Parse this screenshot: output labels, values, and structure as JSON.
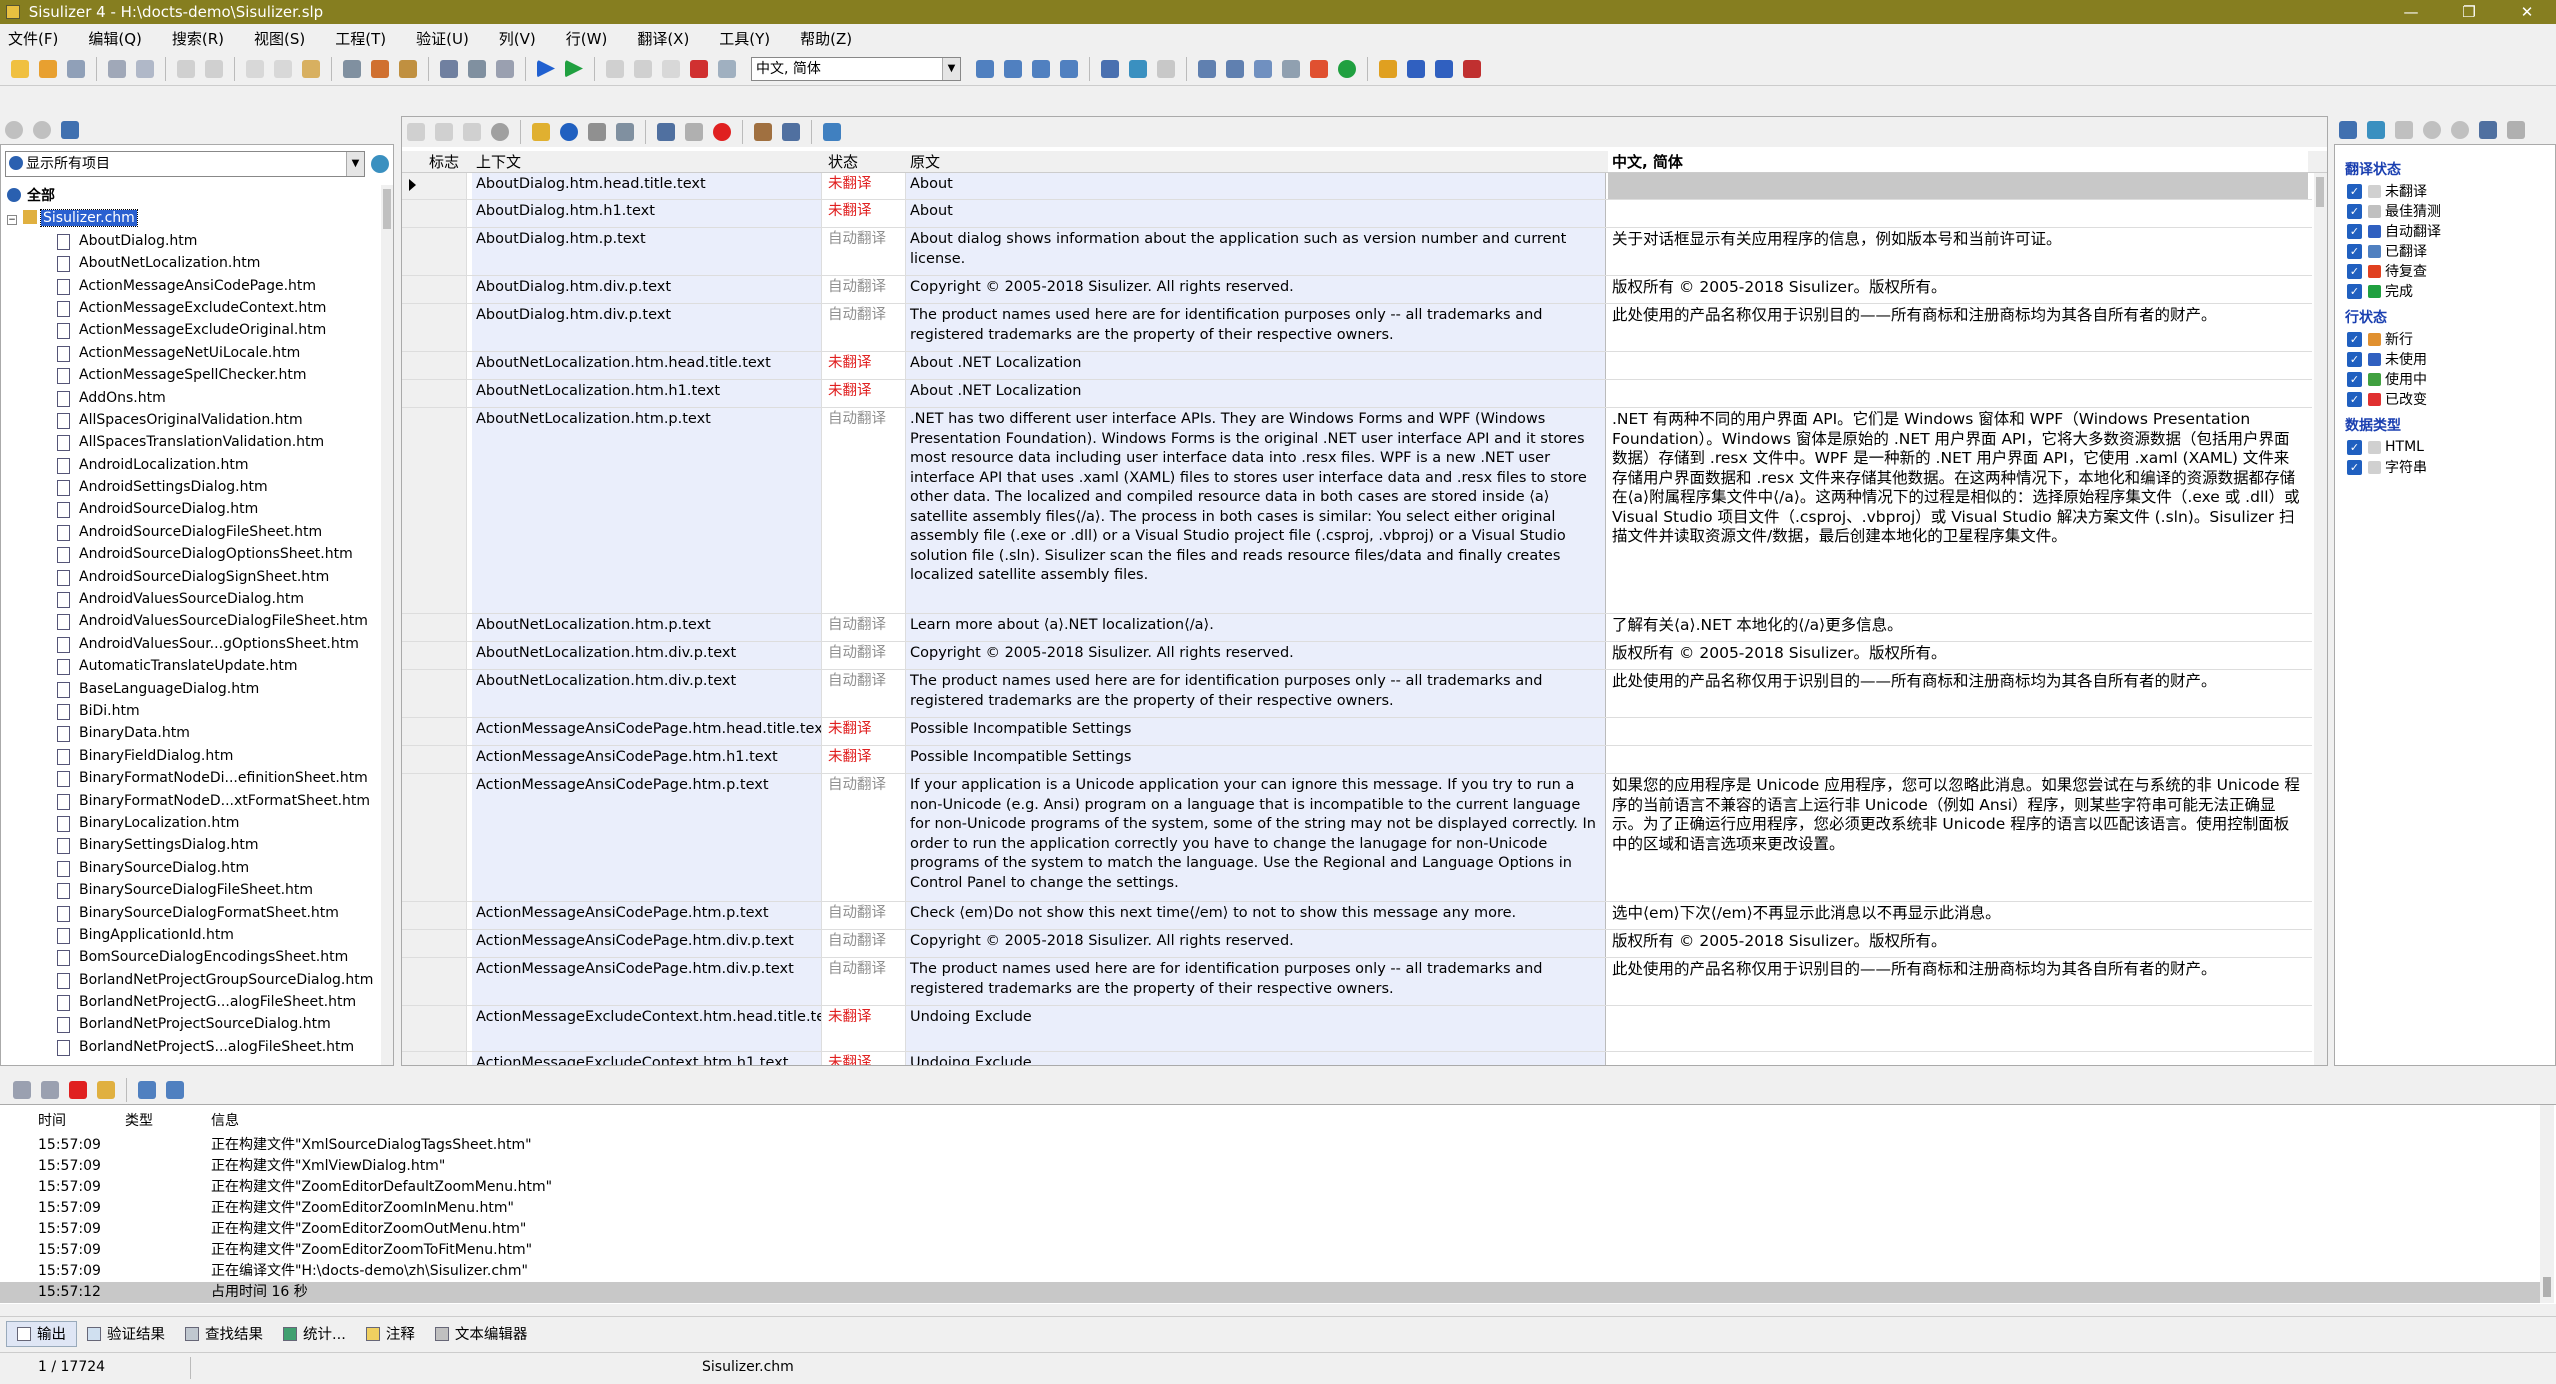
{
  "window": {
    "title": "Sisulizer 4 - H:\\docts-demo\\Sisulizer.slp",
    "minimize": "—",
    "maximize": "❐",
    "close": "✕"
  },
  "menu": [
    "文件(F)",
    "编辑(Q)",
    "搜索(R)",
    "视图(S)",
    "工程(T)",
    "验证(U)",
    "列(V)",
    "行(W)",
    "翻译(X)",
    "工具(Y)",
    "帮助(Z)"
  ],
  "toolbar": {
    "language": "中文, 简体"
  },
  "left": {
    "filter": "显示所有项目",
    "root": "全部",
    "project": "Sisulizer.chm",
    "files": [
      "AboutDialog.htm",
      "AboutNetLocalization.htm",
      "ActionMessageAnsiCodePage.htm",
      "ActionMessageExcludeContext.htm",
      "ActionMessageExcludeOriginal.htm",
      "ActionMessageNetUiLocale.htm",
      "ActionMessageSpellChecker.htm",
      "AddOns.htm",
      "AllSpacesOriginalValidation.htm",
      "AllSpacesTranslationValidation.htm",
      "AndroidLocalization.htm",
      "AndroidSettingsDialog.htm",
      "AndroidSourceDialog.htm",
      "AndroidSourceDialogFileSheet.htm",
      "AndroidSourceDialogOptionsSheet.htm",
      "AndroidSourceDialogSignSheet.htm",
      "AndroidValuesSourceDialog.htm",
      "AndroidValuesSourceDialogFileSheet.htm",
      "AndroidValuesSour...gOptionsSheet.htm",
      "AutomaticTranslateUpdate.htm",
      "BaseLanguageDialog.htm",
      "BiDi.htm",
      "BinaryData.htm",
      "BinaryFieldDialog.htm",
      "BinaryFormatNodeDi...efinitionSheet.htm",
      "BinaryFormatNodeD...xtFormatSheet.htm",
      "BinaryLocalization.htm",
      "BinarySettingsDialog.htm",
      "BinarySourceDialog.htm",
      "BinarySourceDialogFileSheet.htm",
      "BinarySourceDialogFormatSheet.htm",
      "BingApplicationId.htm",
      "BomSourceDialogEncodingsSheet.htm",
      "BorlandNetProjectGroupSourceDialog.htm",
      "BorlandNetProjectG...alogFileSheet.htm",
      "BorlandNetProjectSourceDialog.htm",
      "BorlandNetProjectS...alogFileSheet.htm"
    ]
  },
  "grid": {
    "headers": {
      "flag": "标志",
      "context": "上下文",
      "status": "状态",
      "original": "原文",
      "target": "中文, 简体"
    },
    "rows": [
      {
        "ctx": "AboutDialog.htm.head.title.text",
        "st": "未翻译",
        "src": "About",
        "tgt": ""
      },
      {
        "ctx": "AboutDialog.htm.h1.text",
        "st": "未翻译",
        "src": "About",
        "tgt": ""
      },
      {
        "ctx": "AboutDialog.htm.p.text",
        "st": "自动翻译",
        "src": "About dialog shows information about the application such as version number and current license.",
        "tgt": "关于对话框显示有关应用程序的信息，例如版本号和当前许可证。"
      },
      {
        "ctx": "AboutDialog.htm.div.p.text",
        "st": "自动翻译",
        "src": "Copyright © 2005-2018 Sisulizer. All rights reserved.",
        "tgt": "版权所有 © 2005-2018 Sisulizer。版权所有。"
      },
      {
        "ctx": "AboutDialog.htm.div.p.text",
        "st": "自动翻译",
        "src": "The product names used here are for identification purposes only -- all trademarks and registered trademarks are the property of their respective owners.",
        "tgt": "此处使用的产品名称仅用于识别目的——所有商标和注册商标均为其各自所有者的财产。"
      },
      {
        "ctx": "AboutNetLocalization.htm.head.title.text",
        "st": "未翻译",
        "src": "About .NET Localization",
        "tgt": ""
      },
      {
        "ctx": "AboutNetLocalization.htm.h1.text",
        "st": "未翻译",
        "src": "About .NET Localization",
        "tgt": ""
      },
      {
        "ctx": "AboutNetLocalization.htm.p.text",
        "st": "自动翻译",
        "src": ".NET has two different user interface APIs. They are Windows Forms and WPF (Windows Presentation Foundation). Windows Forms is the original .NET user interface API and it stores most resource data including user interface data into .resx files. WPF is a new .NET user interface API that uses .xaml (XAML) files to stores user interface data and .resx files to store other data. The localized and compiled resource data in both cases are stored inside ⟨a⟩satellite assembly files⟨/a⟩. The process in both cases is similar: You select either original assembly file (.exe or .dll) or a Visual Studio project file (.csproj, .vbproj) or a Visual Studio solution file (.sln). Sisulizer scan the files and reads resource files/data and finally creates localized satellite assembly files.",
        "tgt": ".NET 有两种不同的用户界面 API。它们是 Windows 窗体和 WPF（Windows Presentation Foundation）。Windows 窗体是原始的 .NET 用户界面 API，它将大多数资源数据（包括用户界面数据）存储到 .resx 文件中。WPF 是一种新的 .NET 用户界面 API，它使用 .xaml (XAML) 文件来存储用户界面数据和 .resx 文件来存储其他数据。在这两种情况下，本地化和编译的资源数据都存储在⟨a⟩附属程序集文件中⟨/a⟩。这两种情况下的过程是相似的：选择原始程序集文件（.exe 或 .dll）或 Visual Studio 项目文件（.csproj、.vbproj）或 Visual Studio 解决方案文件 (.sln)。Sisulizer 扫描文件并读取资源文件/数据，最后创建本地化的卫星程序集文件。"
      },
      {
        "ctx": "AboutNetLocalization.htm.p.text",
        "st": "自动翻译",
        "src": "Learn more about ⟨a⟩.NET localization⟨/a⟩.",
        "tgt": "了解有关⟨a⟩.NET 本地化的⟨/a⟩更多信息。"
      },
      {
        "ctx": "AboutNetLocalization.htm.div.p.text",
        "st": "自动翻译",
        "src": "Copyright © 2005-2018 Sisulizer. All rights reserved.",
        "tgt": "版权所有 © 2005-2018 Sisulizer。版权所有。"
      },
      {
        "ctx": "AboutNetLocalization.htm.div.p.text",
        "st": "自动翻译",
        "src": "The product names used here are for identification purposes only -- all trademarks and registered trademarks are the property of their respective owners.",
        "tgt": "此处使用的产品名称仅用于识别目的——所有商标和注册商标均为其各自所有者的财产。"
      },
      {
        "ctx": "ActionMessageAnsiCodePage.htm.head.title.text",
        "st": "未翻译",
        "src": "Possible Incompatible Settings",
        "tgt": ""
      },
      {
        "ctx": "ActionMessageAnsiCodePage.htm.h1.text",
        "st": "未翻译",
        "src": "Possible Incompatible Settings",
        "tgt": ""
      },
      {
        "ctx": "ActionMessageAnsiCodePage.htm.p.text",
        "st": "自动翻译",
        "src": "If your application is a Unicode application your can ignore this message. If you try to run a non-Unicode (e.g. Ansi) program on a language that is incompatible to the current language for non-Unicode programs of the system, some of the string may not be displayed correctly. In order to run the application correctly you have to change the lanugage for non-Unicode programs of the system to match the language. Use the Regional and Language Options in Control Panel to change the settings.",
        "tgt": "如果您的应用程序是 Unicode 应用程序，您可以忽略此消息。如果您尝试在与系统的非 Unicode 程序的当前语言不兼容的语言上运行非 Unicode（例如 Ansi）程序，则某些字符串可能无法正确显示。为了正确运行应用程序，您必须更改系统非 Unicode 程序的语言以匹配该语言。使用控制面板中的区域和语言选项来更改设置。"
      },
      {
        "ctx": "ActionMessageAnsiCodePage.htm.p.text",
        "st": "自动翻译",
        "src": "Check ⟨em⟩Do not show this next time⟨/em⟩ to not to show this message any more.",
        "tgt": "选中⟨em⟩下次⟨/em⟩不再显示此消息以不再显示此消息。"
      },
      {
        "ctx": "ActionMessageAnsiCodePage.htm.div.p.text",
        "st": "自动翻译",
        "src": "Copyright © 2005-2018 Sisulizer. All rights reserved.",
        "tgt": "版权所有 © 2005-2018 Sisulizer。版权所有。"
      },
      {
        "ctx": "ActionMessageAnsiCodePage.htm.div.p.text",
        "st": "自动翻译",
        "src": "The product names used here are for identification purposes only -- all trademarks and registered trademarks are the property of their respective owners.",
        "tgt": "此处使用的产品名称仅用于识别目的——所有商标和注册商标均为其各自所有者的财产。"
      },
      {
        "ctx": "ActionMessageExcludeContext.htm.head.title.text",
        "st": "未翻译",
        "src": "Undoing Exclude",
        "tgt": ""
      },
      {
        "ctx": "ActionMessageExcludeContext.htm.h1.text",
        "st": "未翻译",
        "src": "Undoing Exclude",
        "tgt": ""
      }
    ]
  },
  "right": {
    "sections": [
      {
        "title": "翻译状态",
        "items": [
          "未翻译",
          "最佳猜测",
          "自动翻译",
          "已翻译",
          "待复查",
          "完成"
        ]
      },
      {
        "title": "行状态",
        "items": [
          "新行",
          "未使用",
          "使用中",
          "已改变"
        ]
      },
      {
        "title": "数据类型",
        "items": [
          "HTML",
          "字符串"
        ]
      }
    ]
  },
  "output": {
    "headers": {
      "time": "时间",
      "kind": "类型",
      "msg": "信息"
    },
    "lines": [
      {
        "time": "15:57:09",
        "msg": "正在构建文件\"XmlSourceDialogTagsSheet.htm\""
      },
      {
        "time": "15:57:09",
        "msg": "正在构建文件\"XmlViewDialog.htm\""
      },
      {
        "time": "15:57:09",
        "msg": "正在构建文件\"ZoomEditorDefaultZoomMenu.htm\""
      },
      {
        "time": "15:57:09",
        "msg": "正在构建文件\"ZoomEditorZoomInMenu.htm\""
      },
      {
        "time": "15:57:09",
        "msg": "正在构建文件\"ZoomEditorZoomOutMenu.htm\""
      },
      {
        "time": "15:57:09",
        "msg": "正在构建文件\"ZoomEditorZoomToFitMenu.htm\""
      },
      {
        "time": "15:57:09",
        "msg": "正在编译文件\"H:\\docts-demo\\zh\\Sisulizer.chm\""
      },
      {
        "time": "15:57:12",
        "msg": "占用时间 16 秒"
      }
    ]
  },
  "tabs": [
    "输出",
    "验证结果",
    "查找结果",
    "统计...",
    "注释",
    "文本编辑器"
  ],
  "status": {
    "position": "1 / 17724",
    "file": "Sisulizer.chm"
  }
}
